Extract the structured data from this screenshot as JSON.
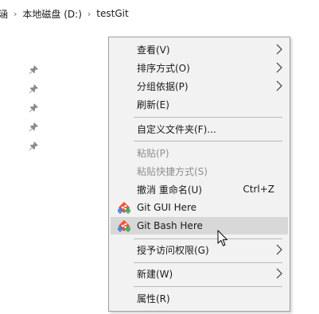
{
  "breadcrumb": {
    "items": [
      "涵",
      "本地磁盘 (D:)",
      "testGit"
    ],
    "separator": "›"
  },
  "quick_access": {
    "pins": [
      "pin-icon",
      "pin-icon",
      "pin-icon",
      "pin-icon",
      "pin-icon"
    ]
  },
  "context_menu": {
    "view": "查看(V)",
    "sort_by": "排序方式(O)",
    "group_by": "分组依据(P)",
    "refresh": "刷新(E)",
    "customize_folder": "自定义文件夹(F)...",
    "paste": "粘贴(P)",
    "paste_shortcut": "粘贴快捷方式(S)",
    "undo_rename": "撤消 重命名(U)",
    "undo_rename_shortcut": "Ctrl+Z",
    "git_gui": "Git GUI Here",
    "git_bash": "Git Bash Here",
    "give_access": "授予访问权限(G)",
    "new": "新建(W)",
    "properties": "属性(R)"
  },
  "colors": {
    "menu_background": "#f2f2f2",
    "hover_background": "#d8d8d8",
    "disabled_text": "#8f8f8f",
    "git_brand": "#f05133"
  }
}
